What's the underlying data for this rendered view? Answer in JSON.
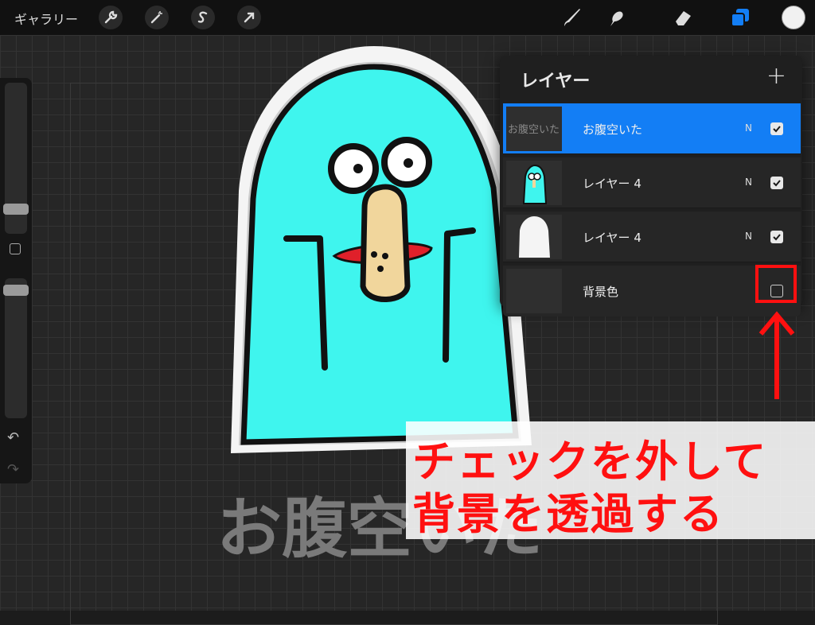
{
  "topbar": {
    "gallery_label": "ギャラリー",
    "left_tools": [
      "wrench-icon",
      "magic-wand-icon",
      "selection-s-icon",
      "move-arrow-icon"
    ],
    "right_tools": [
      "brush-icon",
      "smudge-icon",
      "eraser-icon",
      "layers-icon"
    ],
    "active_color": "#f1f1f1",
    "accent": "#137ef5"
  },
  "sidebar": {
    "undo_icon": "↶",
    "redo_icon": "↷"
  },
  "layers": {
    "title": "レイヤー",
    "add_icon": "+",
    "items": [
      {
        "name": "お腹空いた",
        "thumb_text": "お腹空いた",
        "blend": "N",
        "visible": true,
        "active": true
      },
      {
        "name": "レイヤー 4",
        "thumb_text": "",
        "blend": "N",
        "visible": true,
        "active": false
      },
      {
        "name": "レイヤー 4",
        "thumb_text": "",
        "blend": "N",
        "visible": true,
        "active": false
      },
      {
        "name": "背景色",
        "thumb_text": "",
        "blend": "",
        "visible": false,
        "active": false
      }
    ]
  },
  "canvas": {
    "drawn_text": "お腹空いた",
    "character_color": "#3ff5ee"
  },
  "annotation": {
    "line1": "チェックを外して",
    "line2": "背景を透過する",
    "color": "#ff1010"
  }
}
